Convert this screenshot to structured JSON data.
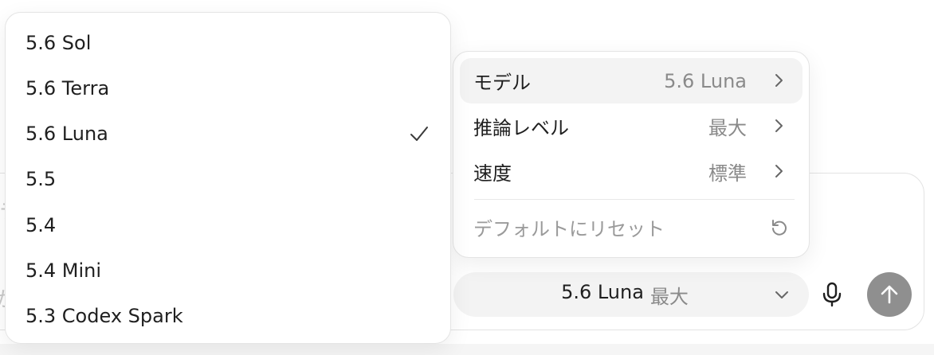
{
  "model_menu": {
    "items": [
      {
        "label": "5.6 Sol",
        "selected": false
      },
      {
        "label": "5.6 Terra",
        "selected": false
      },
      {
        "label": "5.6 Luna",
        "selected": true
      },
      {
        "label": "5.5",
        "selected": false
      },
      {
        "label": "5.4",
        "selected": false
      },
      {
        "label": "5.4 Mini",
        "selected": false
      },
      {
        "label": "5.3 Codex Spark",
        "selected": false
      }
    ]
  },
  "settings_menu": {
    "rows": [
      {
        "label": "モデル",
        "value": "5.6 Luna",
        "icon": "chevron-right-icon"
      },
      {
        "label": "推論レベル",
        "value": "最大",
        "icon": "chevron-right-icon"
      },
      {
        "label": "速度",
        "value": "標準",
        "icon": "chevron-right-icon"
      }
    ],
    "reset_label": "デフォルトにリセット",
    "reset_icon": "reset-icon"
  },
  "composer": {
    "model_label": "5.6 Luna",
    "effort_label": "最大",
    "send_color": "#8f8f8f"
  },
  "colors": {
    "muted_text": "#8a8a8a",
    "active_row": "#f3f3f3"
  }
}
